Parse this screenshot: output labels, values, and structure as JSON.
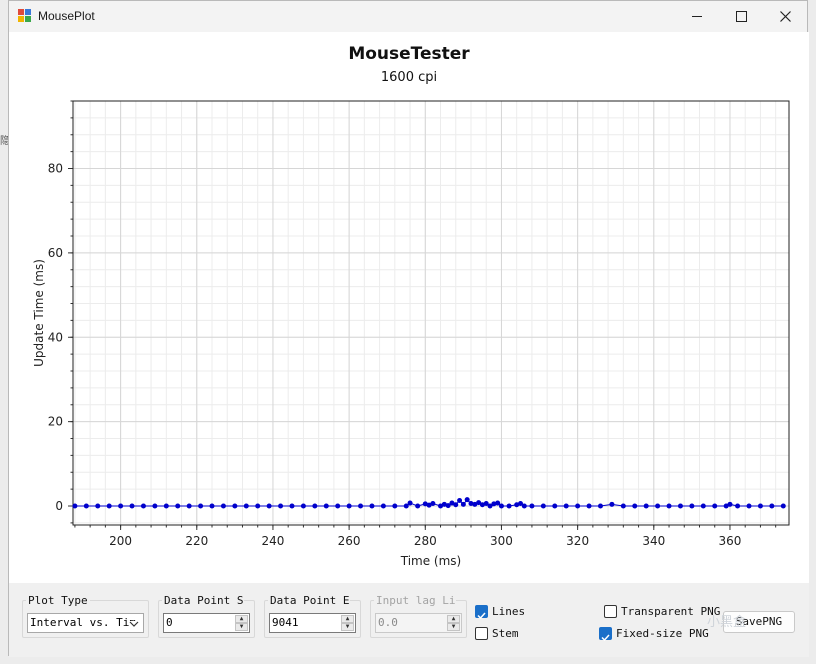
{
  "window": {
    "title": "MousePlot",
    "minimize_glyph": "—",
    "maximize_glyph": "☐",
    "close_glyph": "✕"
  },
  "edge_fragment": "隐",
  "chart_data": {
    "type": "scatter",
    "title": "MouseTester",
    "subtitle": "1600 cpi",
    "xlabel": "Time (ms)",
    "ylabel": "Update Time (ms)",
    "xlim": [
      187.5,
      375.5
    ],
    "ylim": [
      -4.5,
      96
    ],
    "xticks": [
      200,
      220,
      240,
      260,
      280,
      300,
      320,
      340,
      360
    ],
    "yticks": [
      0,
      20,
      40,
      60,
      80
    ],
    "grid": true,
    "lines": true,
    "marker_color": "#0000cc",
    "series": [
      {
        "x": [
          188,
          191,
          194,
          197,
          200,
          203,
          206,
          209,
          212,
          215,
          218,
          221,
          224,
          227,
          230,
          233,
          236,
          239,
          242,
          245,
          248,
          251,
          254,
          257,
          260,
          263,
          266,
          269,
          272,
          275,
          276,
          278,
          280,
          281,
          282,
          284,
          285,
          286,
          287,
          288,
          289,
          290,
          291,
          292,
          293,
          294,
          295,
          296,
          297,
          298,
          299,
          300,
          302,
          304,
          305,
          306,
          308,
          311,
          314,
          317,
          320,
          323,
          326,
          329,
          332,
          335,
          338,
          341,
          344,
          347,
          350,
          353,
          356,
          359,
          360,
          362,
          365,
          368,
          371,
          374
        ],
        "y": [
          0,
          0,
          0,
          0,
          0,
          0,
          0,
          0,
          0,
          0,
          0,
          0,
          0,
          0,
          0,
          0,
          0,
          0,
          0,
          0,
          0,
          0,
          0,
          0,
          0,
          0,
          0,
          0,
          0,
          0,
          0.7,
          0,
          0.5,
          0.2,
          0.6,
          0,
          0.4,
          0.1,
          0.7,
          0.3,
          1.3,
          0.4,
          1.5,
          0.6,
          0.4,
          0.8,
          0.3,
          0.6,
          0,
          0.5,
          0.7,
          0,
          0,
          0.3,
          0.6,
          0,
          0,
          0,
          0,
          0,
          0,
          0,
          0,
          0.4,
          0,
          0,
          0,
          0,
          0,
          0,
          0,
          0,
          0,
          0,
          0.4,
          0,
          0,
          0,
          0,
          0
        ]
      }
    ]
  },
  "controls": {
    "plot_type": {
      "label": "Plot Type",
      "value": "Interval vs. Tim"
    },
    "data_point_start": {
      "label": "Data Point Start",
      "value": "0"
    },
    "data_point_end": {
      "label": "Data Point End",
      "value": "9041"
    },
    "input_lag": {
      "label": "Input lag Line",
      "value": "0.0"
    },
    "lines": {
      "label": "Lines",
      "checked": true
    },
    "stem": {
      "label": "Stem",
      "checked": false
    },
    "transparent_png": {
      "label": "Transparent PNG",
      "checked": false
    },
    "fixed_size_png": {
      "label": "Fixed-size PNG",
      "checked": true
    },
    "save_png": {
      "label": "SavePNG"
    }
  },
  "watermark": "小黑盒"
}
